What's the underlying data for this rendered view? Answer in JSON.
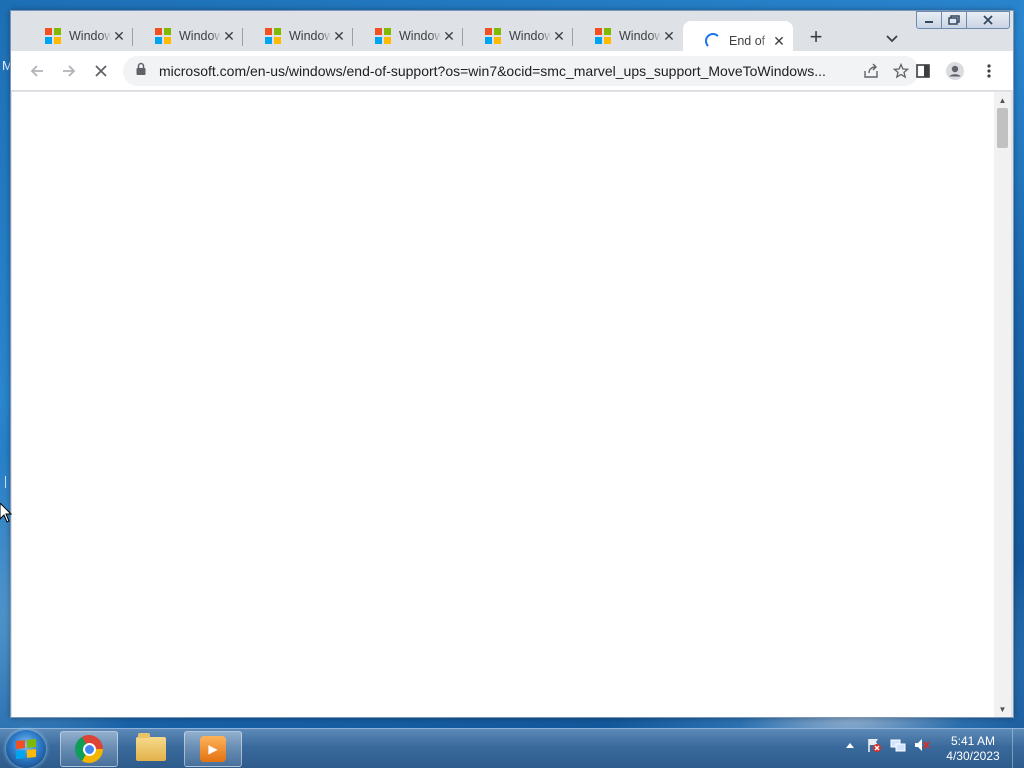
{
  "desktop": {
    "edge_letter": "M"
  },
  "browser": {
    "tabs": [
      {
        "label": "Windows",
        "favicon": "microsoft-logo-icon"
      },
      {
        "label": "Windows",
        "favicon": "microsoft-logo-icon"
      },
      {
        "label": "Windows",
        "favicon": "microsoft-logo-icon"
      },
      {
        "label": "Windows",
        "favicon": "microsoft-logo-icon"
      },
      {
        "label": "Windows",
        "favicon": "microsoft-logo-icon"
      },
      {
        "label": "Windows",
        "favicon": "microsoft-logo-icon"
      },
      {
        "label": "End of Support",
        "favicon": "loading-spinner-icon",
        "active": true
      }
    ],
    "new_tab": "+",
    "url": "microsoft.com/en-us/windows/end-of-support?os=win7&ocid=smc_marvel_ups_support_MoveToWindows...",
    "page_state": "loading"
  },
  "taskbar": {
    "apps": [
      "chrome-icon",
      "windows-explorer-icon",
      "media-player-icon"
    ],
    "clock_time": "5:41 AM",
    "clock_date": "4/30/2023"
  },
  "colors": {
    "accent": "#1a73e8",
    "tab_strip": "#dee1e6",
    "ms_red": "#f25022",
    "ms_green": "#7fba00",
    "ms_blue": "#00a4ef",
    "ms_yellow": "#ffb900"
  }
}
